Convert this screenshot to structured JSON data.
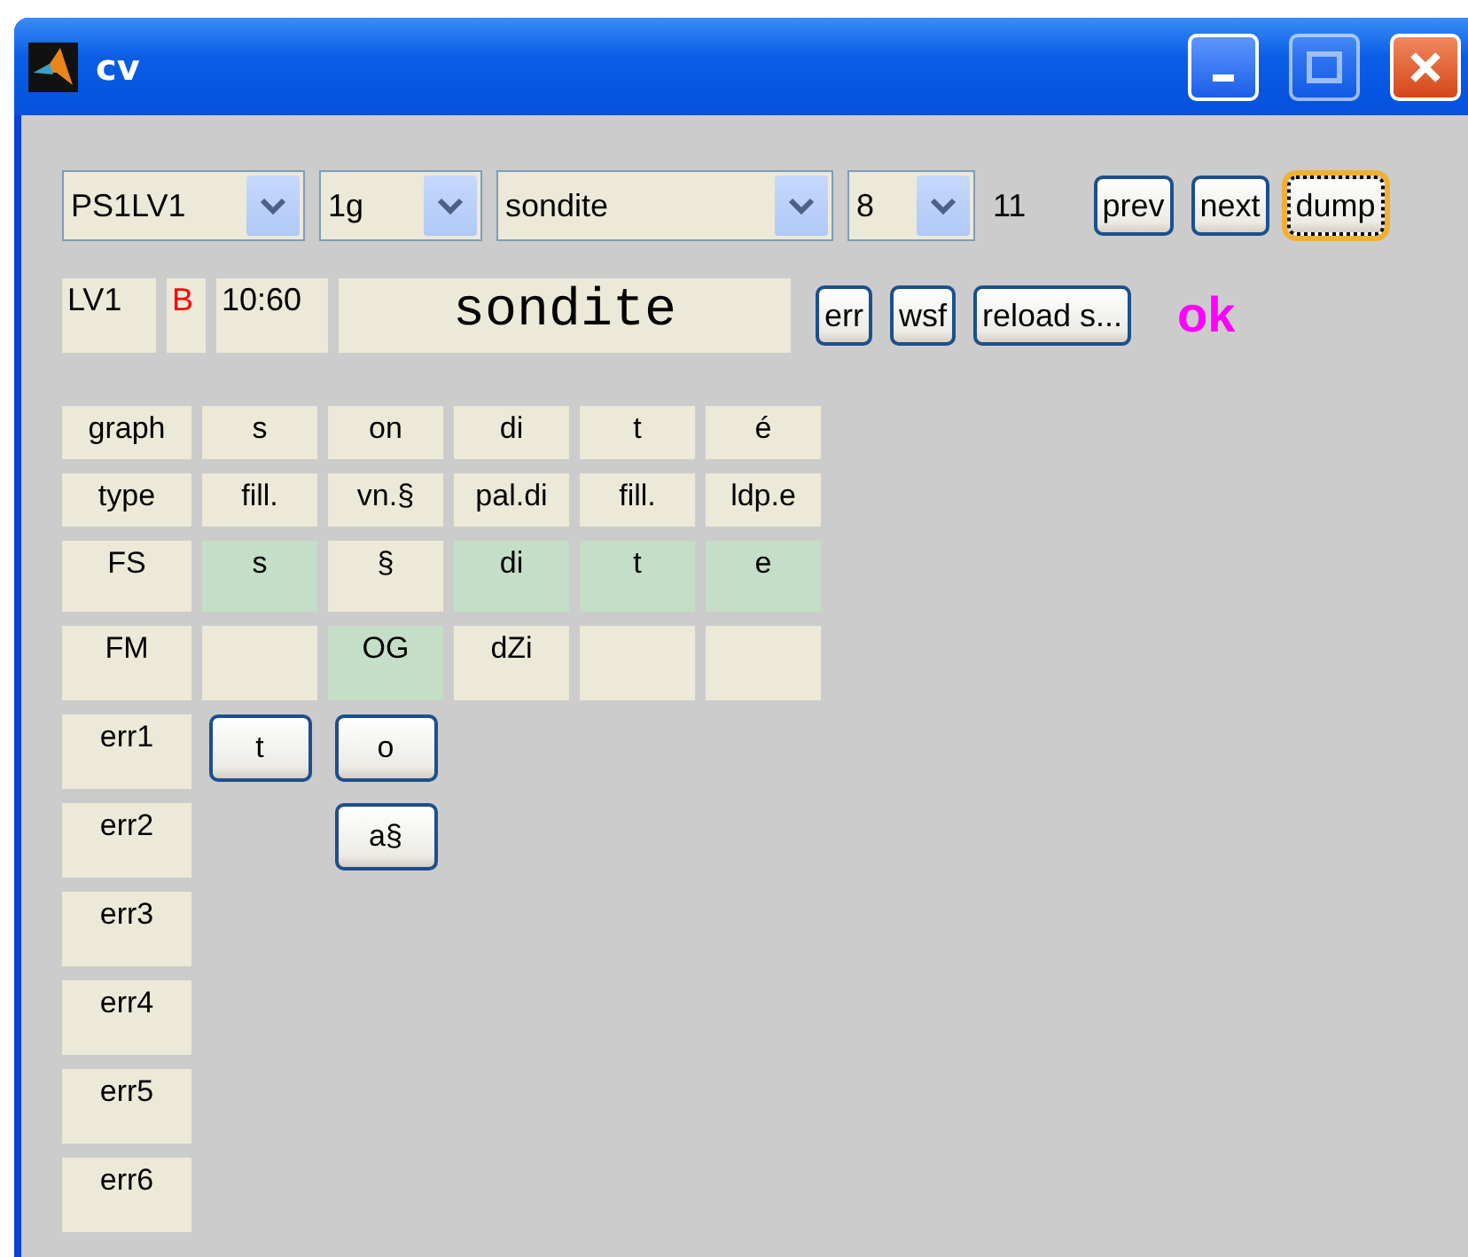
{
  "window": {
    "title": "cv"
  },
  "toolbar": {
    "dropdowns": [
      {
        "value": "PS1LV1",
        "kind": "wide"
      },
      {
        "value": "1g",
        "kind": "narrow"
      },
      {
        "value": "sondite",
        "kind": "long"
      },
      {
        "value": "8",
        "kind": "tiny"
      }
    ],
    "count": "11",
    "buttons": [
      {
        "label": "prev",
        "focused": false
      },
      {
        "label": "next",
        "focused": false
      },
      {
        "label": "dump",
        "focused": true
      }
    ]
  },
  "info": {
    "level": "LV1",
    "flag": "B",
    "time": "10:60",
    "word": "sondite",
    "buttons": [
      "err",
      "wsf",
      "reload s..."
    ],
    "status": "ok"
  },
  "grid": [
    {
      "label": "graph",
      "kind": "short",
      "cells": [
        {
          "text": "s",
          "highlighted": false
        },
        {
          "text": "on",
          "highlighted": false
        },
        {
          "text": "di",
          "highlighted": false
        },
        {
          "text": "t",
          "highlighted": false
        },
        {
          "text": "é",
          "highlighted": false
        }
      ]
    },
    {
      "label": "type",
      "kind": "short",
      "cells": [
        {
          "text": "fill.",
          "highlighted": false
        },
        {
          "text": "vn.§",
          "highlighted": false
        },
        {
          "text": "pal.di",
          "highlighted": false
        },
        {
          "text": "fill.",
          "highlighted": false
        },
        {
          "text": "ldp.e",
          "highlighted": false
        }
      ]
    },
    {
      "label": "FS",
      "kind": "mid",
      "cells": [
        {
          "text": "s",
          "highlighted": true
        },
        {
          "text": "§",
          "highlighted": false
        },
        {
          "text": "di",
          "highlighted": true
        },
        {
          "text": "t",
          "highlighted": true
        },
        {
          "text": "e",
          "highlighted": true
        }
      ]
    },
    {
      "label": "FM",
      "kind": "tall",
      "cells": [
        {
          "highlighted": false
        },
        {
          "text": "OG",
          "highlighted": true
        },
        {
          "text": "dZi",
          "highlighted": false
        },
        {
          "highlighted": false
        },
        {
          "highlighted": false
        }
      ]
    }
  ],
  "errors": [
    {
      "label": "err1",
      "cells": [
        {
          "kind": "button",
          "label": "t"
        },
        {
          "kind": "button",
          "label": "o"
        }
      ]
    },
    {
      "label": "err2",
      "cells": [
        {
          "kind": "blank"
        },
        {
          "kind": "button",
          "label": "a§"
        }
      ]
    },
    {
      "label": "err3"
    },
    {
      "label": "err4"
    },
    {
      "label": "err5"
    },
    {
      "label": "err6"
    }
  ]
}
